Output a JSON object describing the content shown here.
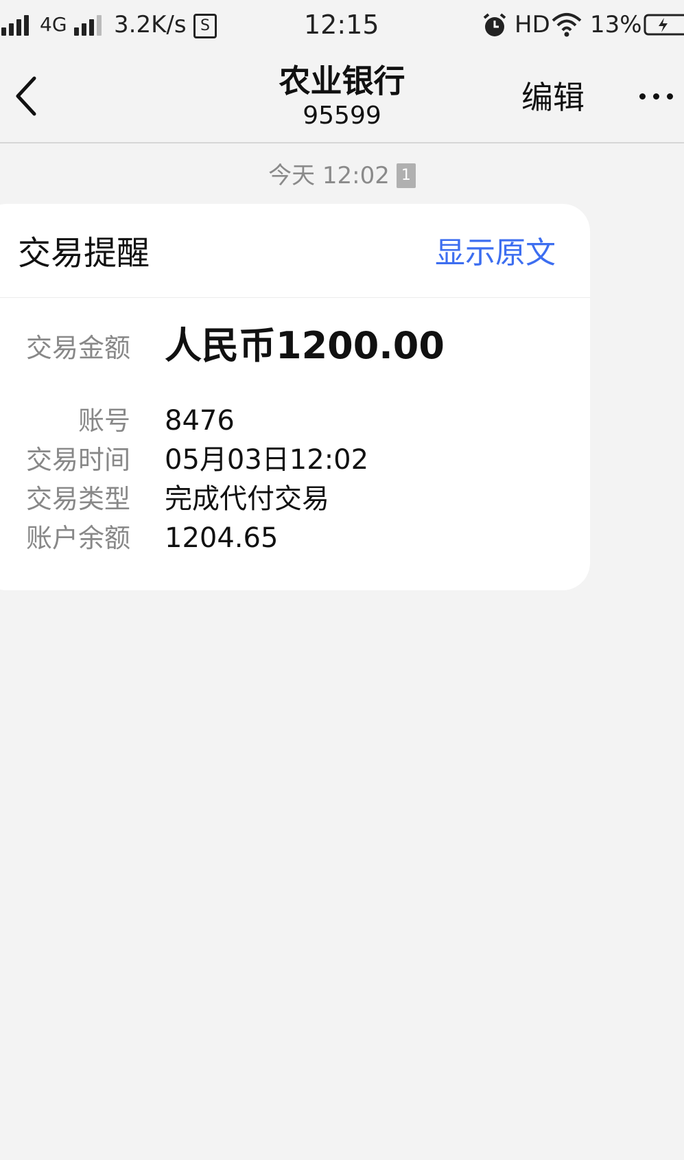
{
  "status_bar": {
    "network": "4G",
    "speed": "3.2K/s",
    "sim_icon": "S",
    "time": "12:15",
    "hd": "HD",
    "battery": "13%"
  },
  "header": {
    "title": "农业银行",
    "subtitle": "95599",
    "edit_label": "编辑"
  },
  "thread": {
    "timestamp": "今天 12:02",
    "sim_badge": "1"
  },
  "message": {
    "title": "交易提醒",
    "show_original": "显示原文",
    "rows": [
      {
        "label": "交易金额",
        "value": "人民币1200.00"
      },
      {
        "label": "账号",
        "value": "8476"
      },
      {
        "label": "交易时间",
        "value": "05月03日12:02"
      },
      {
        "label": "交易类型",
        "value": "完成代付交易"
      },
      {
        "label": "账户余额",
        "value": "1204.65"
      }
    ]
  }
}
